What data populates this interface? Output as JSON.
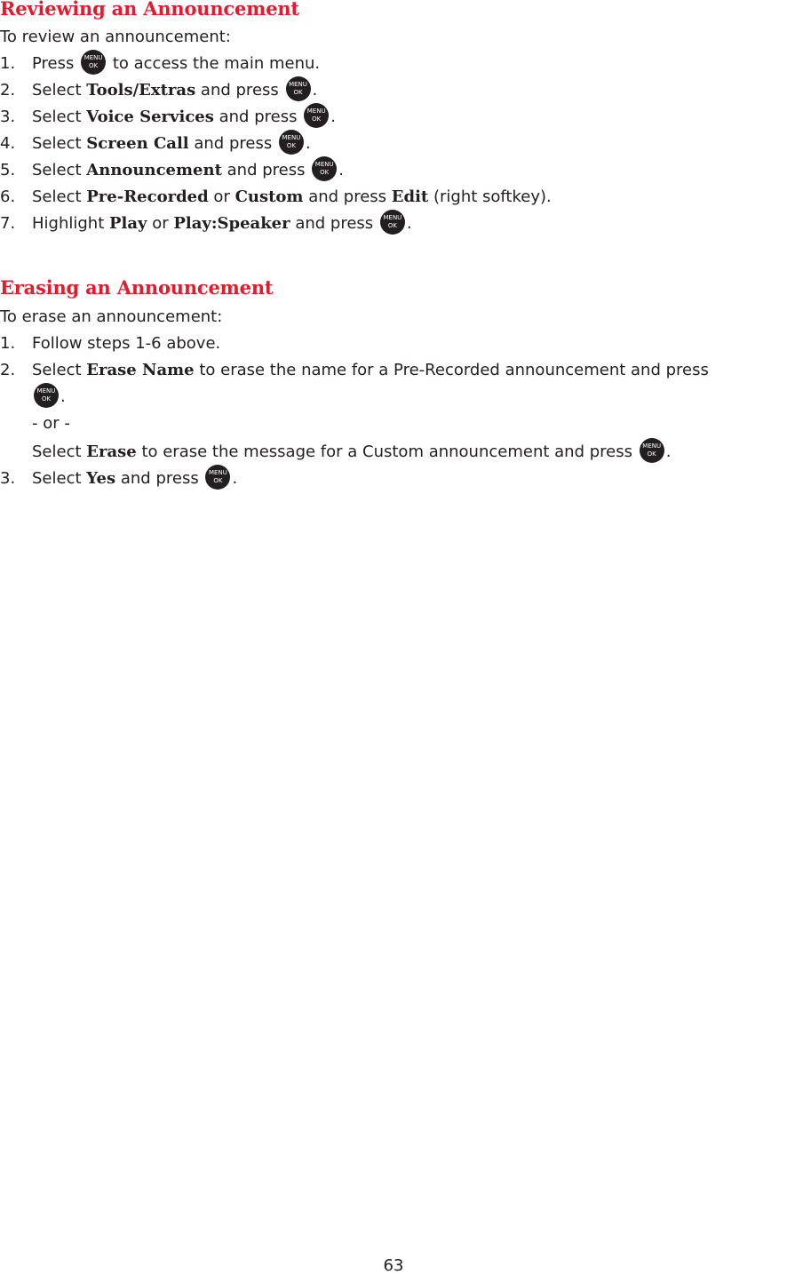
{
  "sections": [
    {
      "title": "Reviewing an Announcement",
      "intro": "To review an announcement:",
      "steps": [
        {
          "n": "1.",
          "parts": [
            "Press ",
            "KEY",
            " to access the main menu."
          ]
        },
        {
          "n": "2.",
          "pre": "Select ",
          "b1": "Tools/Extras",
          "post": " and press "
        },
        {
          "n": "3.",
          "pre": "Select ",
          "b1": "Voice Services",
          "post": " and press "
        },
        {
          "n": "4.",
          "pre": "Select ",
          "b1": "Screen Call",
          "post": " and press "
        },
        {
          "n": "5.",
          "pre": "Select ",
          "b1": "Announcement",
          "post": " and press "
        },
        {
          "n": "6.",
          "pre": "Select ",
          "b1": "Pre-Recorded",
          "mid": " or ",
          "b2": "Custom",
          "post": " and press ",
          "b3": "Edit",
          "tail": " (right softkey)."
        },
        {
          "n": "7.",
          "pre": "Highlight ",
          "b1": "Play",
          "mid": " or ",
          "b2": "Play:Speaker",
          "post": " and press "
        }
      ]
    },
    {
      "title": "Erasing an Announcement",
      "intro": "To erase an announcement:",
      "steps": [
        {
          "n": "1.",
          "text": "Follow steps 1-6 above."
        },
        {
          "n": "2.",
          "pre": "Select ",
          "b1": "Erase Name",
          "post": " to erase the name for a Pre-Recorded announcement and press"
        },
        {
          "or": "- or -"
        },
        {
          "pre": "Select ",
          "b1": "Erase",
          "post": " to erase the message for a Custom announcement and press "
        },
        {
          "n": "3.",
          "pre": "Select ",
          "b1": "Yes",
          "post": " and press "
        }
      ]
    }
  ],
  "step1_pre": "Press ",
  "step1_post": " to access the main menu.",
  "key": {
    "top": "MENU",
    "bottom": "OK",
    "icon": "menu-ok-key-icon"
  },
  "period": ".",
  "page_number": "63"
}
